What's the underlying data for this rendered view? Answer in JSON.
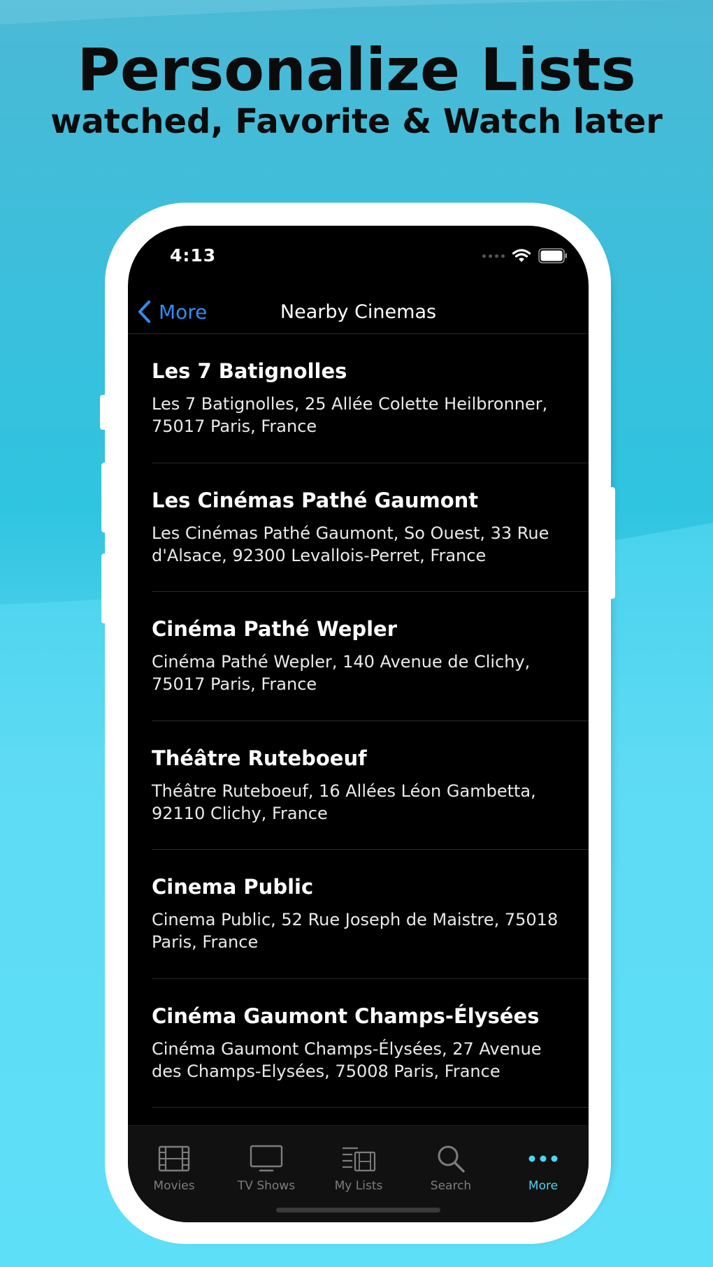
{
  "promo": {
    "headline": "Personalize Lists",
    "subline": "watched, Favorite & Watch later"
  },
  "status_bar": {
    "time": "4:13"
  },
  "nav": {
    "back_label": "More",
    "title": "Nearby Cinemas"
  },
  "cinemas": [
    {
      "name": "Les 7 Batignolles",
      "address": "Les 7 Batignolles, 25 Allée Colette Heilbronner, 75017 Paris, France"
    },
    {
      "name": "Les Cinémas Pathé Gaumont",
      "address": "Les Cinémas Pathé Gaumont, So Ouest, 33 Rue d'Alsace, 92300 Levallois-Perret, France"
    },
    {
      "name": "Cinéma Pathé Wepler",
      "address": "Cinéma Pathé Wepler, 140 Avenue de Clichy, 75017 Paris, France"
    },
    {
      "name": "Théâtre Ruteboeuf",
      "address": "Théâtre Ruteboeuf, 16 Allées Léon Gambetta, 92110 Clichy, France"
    },
    {
      "name": "Cinema Public",
      "address": "Cinema Public, 52 Rue Joseph de Maistre, 75018 Paris, France"
    },
    {
      "name": "Cinéma Gaumont Champs-Élysées",
      "address": "Cinéma Gaumont Champs-Élysées, 27 Avenue des Champs-Elysées, 75008 Paris, France"
    }
  ],
  "tabs": [
    {
      "label": "Movies",
      "icon": "film-icon",
      "active": false
    },
    {
      "label": "TV Shows",
      "icon": "tv-icon",
      "active": false
    },
    {
      "label": "My Lists",
      "icon": "list-icon",
      "active": false
    },
    {
      "label": "Search",
      "icon": "search-icon",
      "active": false
    },
    {
      "label": "More",
      "icon": "more-dots-icon",
      "active": true
    }
  ],
  "colors": {
    "accent_blue": "#2f8df5",
    "active_tab": "#4ed3f2",
    "inactive_tab": "#7d7d7d",
    "screen_bg": "#000000",
    "tabbar_bg": "#111111"
  }
}
